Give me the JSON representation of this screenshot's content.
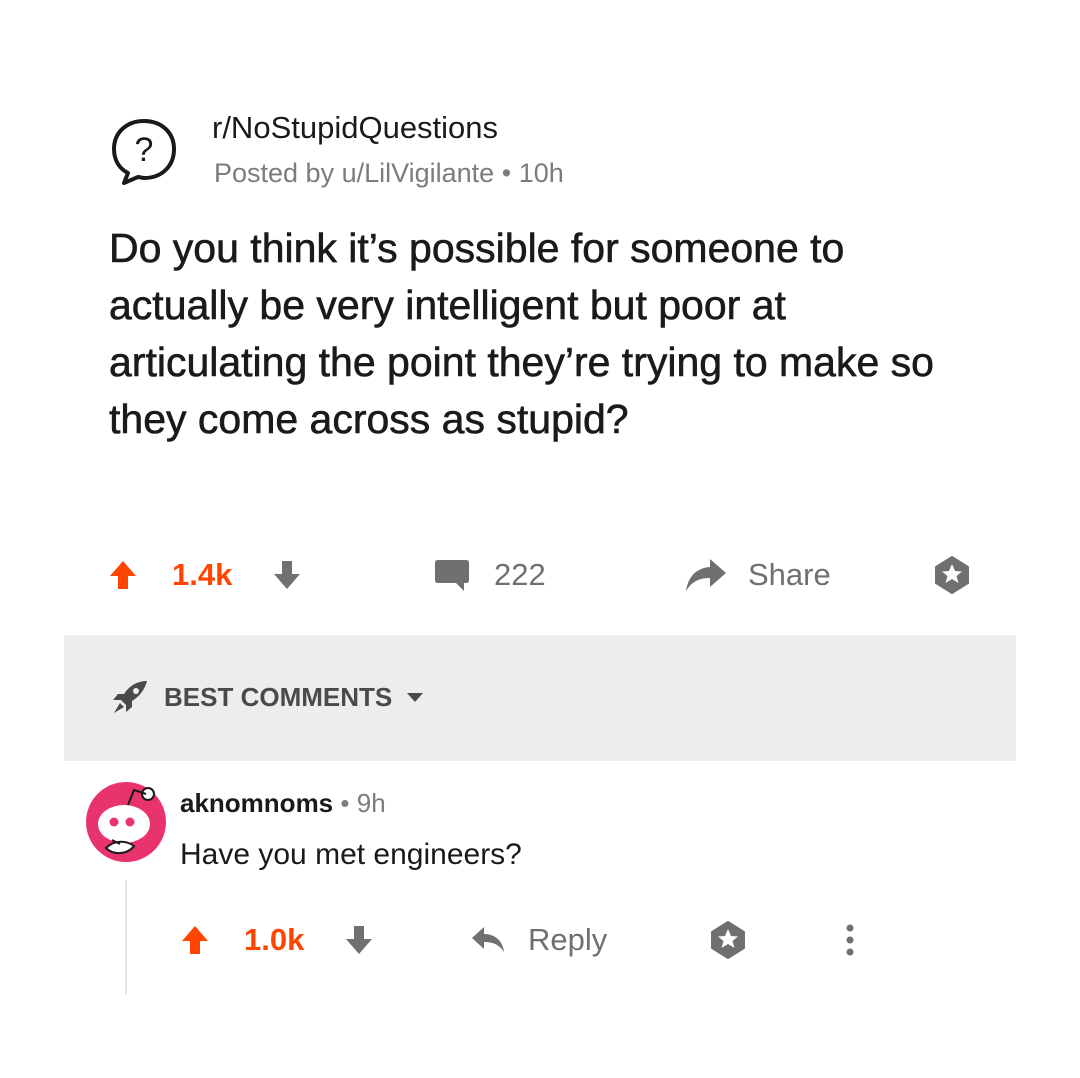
{
  "post": {
    "subreddit": "r/NoStupidQuestions",
    "subreddit_icon": "question-bubble-icon",
    "posted_by": "Posted by u/LilVigilante",
    "separator": "•",
    "age": "10h",
    "title": "Do you think it’s possible for someone to actually be very intelligent but poor at articulating the point they’re trying to make so they come across as stupid?",
    "score": "1.4k",
    "comment_count": "222",
    "share_label": "Share"
  },
  "comments_header": {
    "sort_label": "BEST COMMENTS",
    "sort_icon": "rocket-icon"
  },
  "comment": {
    "author": "aknomnoms",
    "separator": "•",
    "age": "9h",
    "body": "Have you met engineers?",
    "score": "1.0k",
    "reply_label": "Reply"
  },
  "colors": {
    "upvote": "#ff4500",
    "icon_gray": "#707070",
    "meta_gray": "#7c7c7c",
    "section_bg": "#ededf0",
    "avatar_accent": "#e8336d"
  }
}
